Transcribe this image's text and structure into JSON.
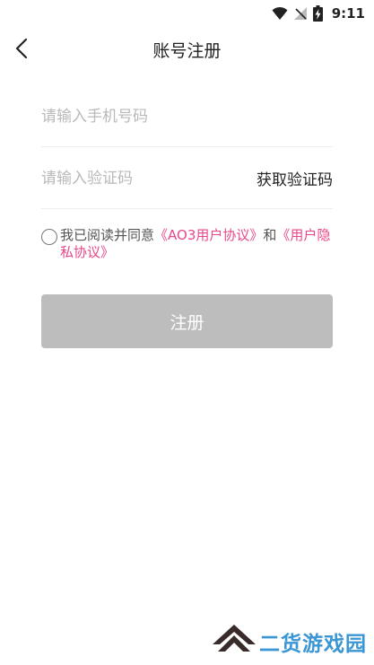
{
  "status_bar": {
    "time": "9:11",
    "icons": [
      "wifi-icon",
      "signal-off-icon",
      "battery-charging-icon"
    ]
  },
  "header": {
    "back_icon": "chevron-left-icon",
    "title": "账号注册"
  },
  "form": {
    "phone_placeholder": "请输入手机号码",
    "code_placeholder": "请输入验证码",
    "get_code_label": "获取验证码"
  },
  "agreement": {
    "prefix": "我已阅读并同意",
    "user_agreement": "《AO3用户协议》",
    "conjunction": "和",
    "privacy_policy": "《用户隐私协议》"
  },
  "register_label": "注册",
  "watermark": {
    "text": "二货游戏园"
  },
  "colors": {
    "accent_link": "#e8478a",
    "button_disabled": "#bdbdbd",
    "watermark": "#3b96d4"
  }
}
